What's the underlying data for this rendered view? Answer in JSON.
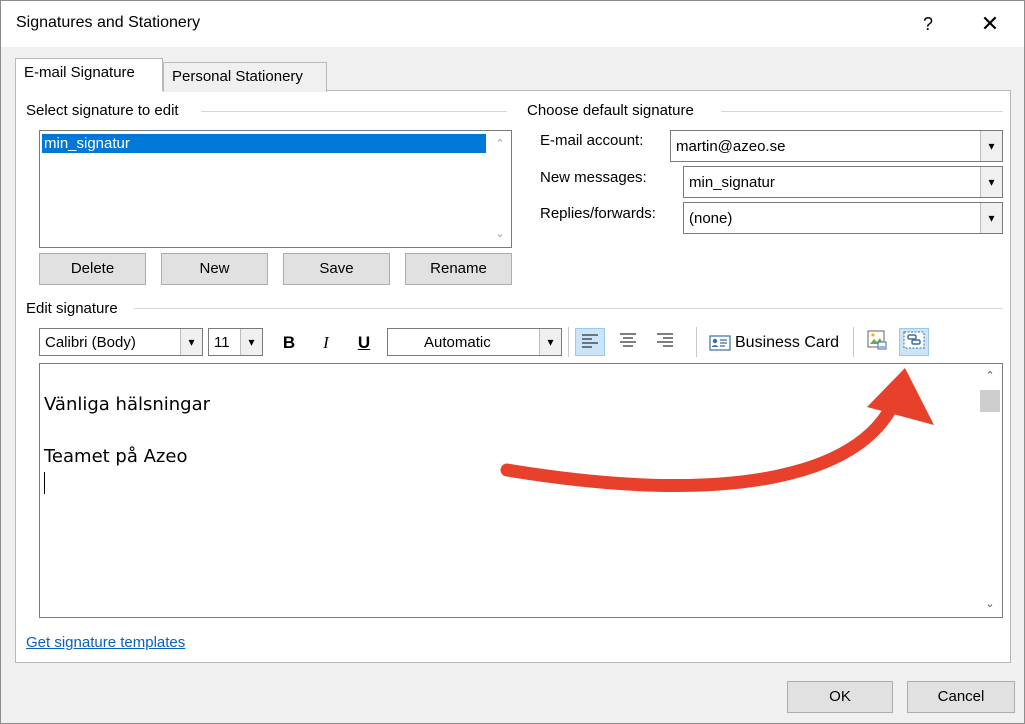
{
  "window": {
    "title": "Signatures and Stationery",
    "help_label": "?",
    "close_label": "✕"
  },
  "tabs": [
    {
      "label": "E-mail Signature",
      "active": true
    },
    {
      "label": "Personal Stationery",
      "active": false
    }
  ],
  "select_signature": {
    "group_title": "Select signature to edit",
    "items": [
      "min_signatur"
    ],
    "selected": "min_signatur"
  },
  "signature_buttons": {
    "delete": "Delete",
    "new": "New",
    "save": "Save",
    "rename": "Rename"
  },
  "default_signature": {
    "group_title": "Choose default signature",
    "email_account_label": "E-mail account:",
    "email_account_value": "martin@azeo.se",
    "new_messages_label": "New messages:",
    "new_messages_value": "min_signatur",
    "replies_label": "Replies/forwards:",
    "replies_value": "(none)"
  },
  "edit_signature": {
    "group_title": "Edit signature",
    "font": "Calibri (Body)",
    "size": "11",
    "bold": "B",
    "italic": "I",
    "underline": "U",
    "color": "Automatic",
    "business_card": "Business Card",
    "lines": [
      "Vänliga hälsningar",
      "",
      "Teamet på Azeo"
    ]
  },
  "footer": {
    "templates_link": "Get signature templates",
    "ok": "OK",
    "cancel": "Cancel"
  },
  "colors": {
    "selection": "#0078d7",
    "annotation_arrow": "#e8402a",
    "link": "#0b5fbd"
  }
}
